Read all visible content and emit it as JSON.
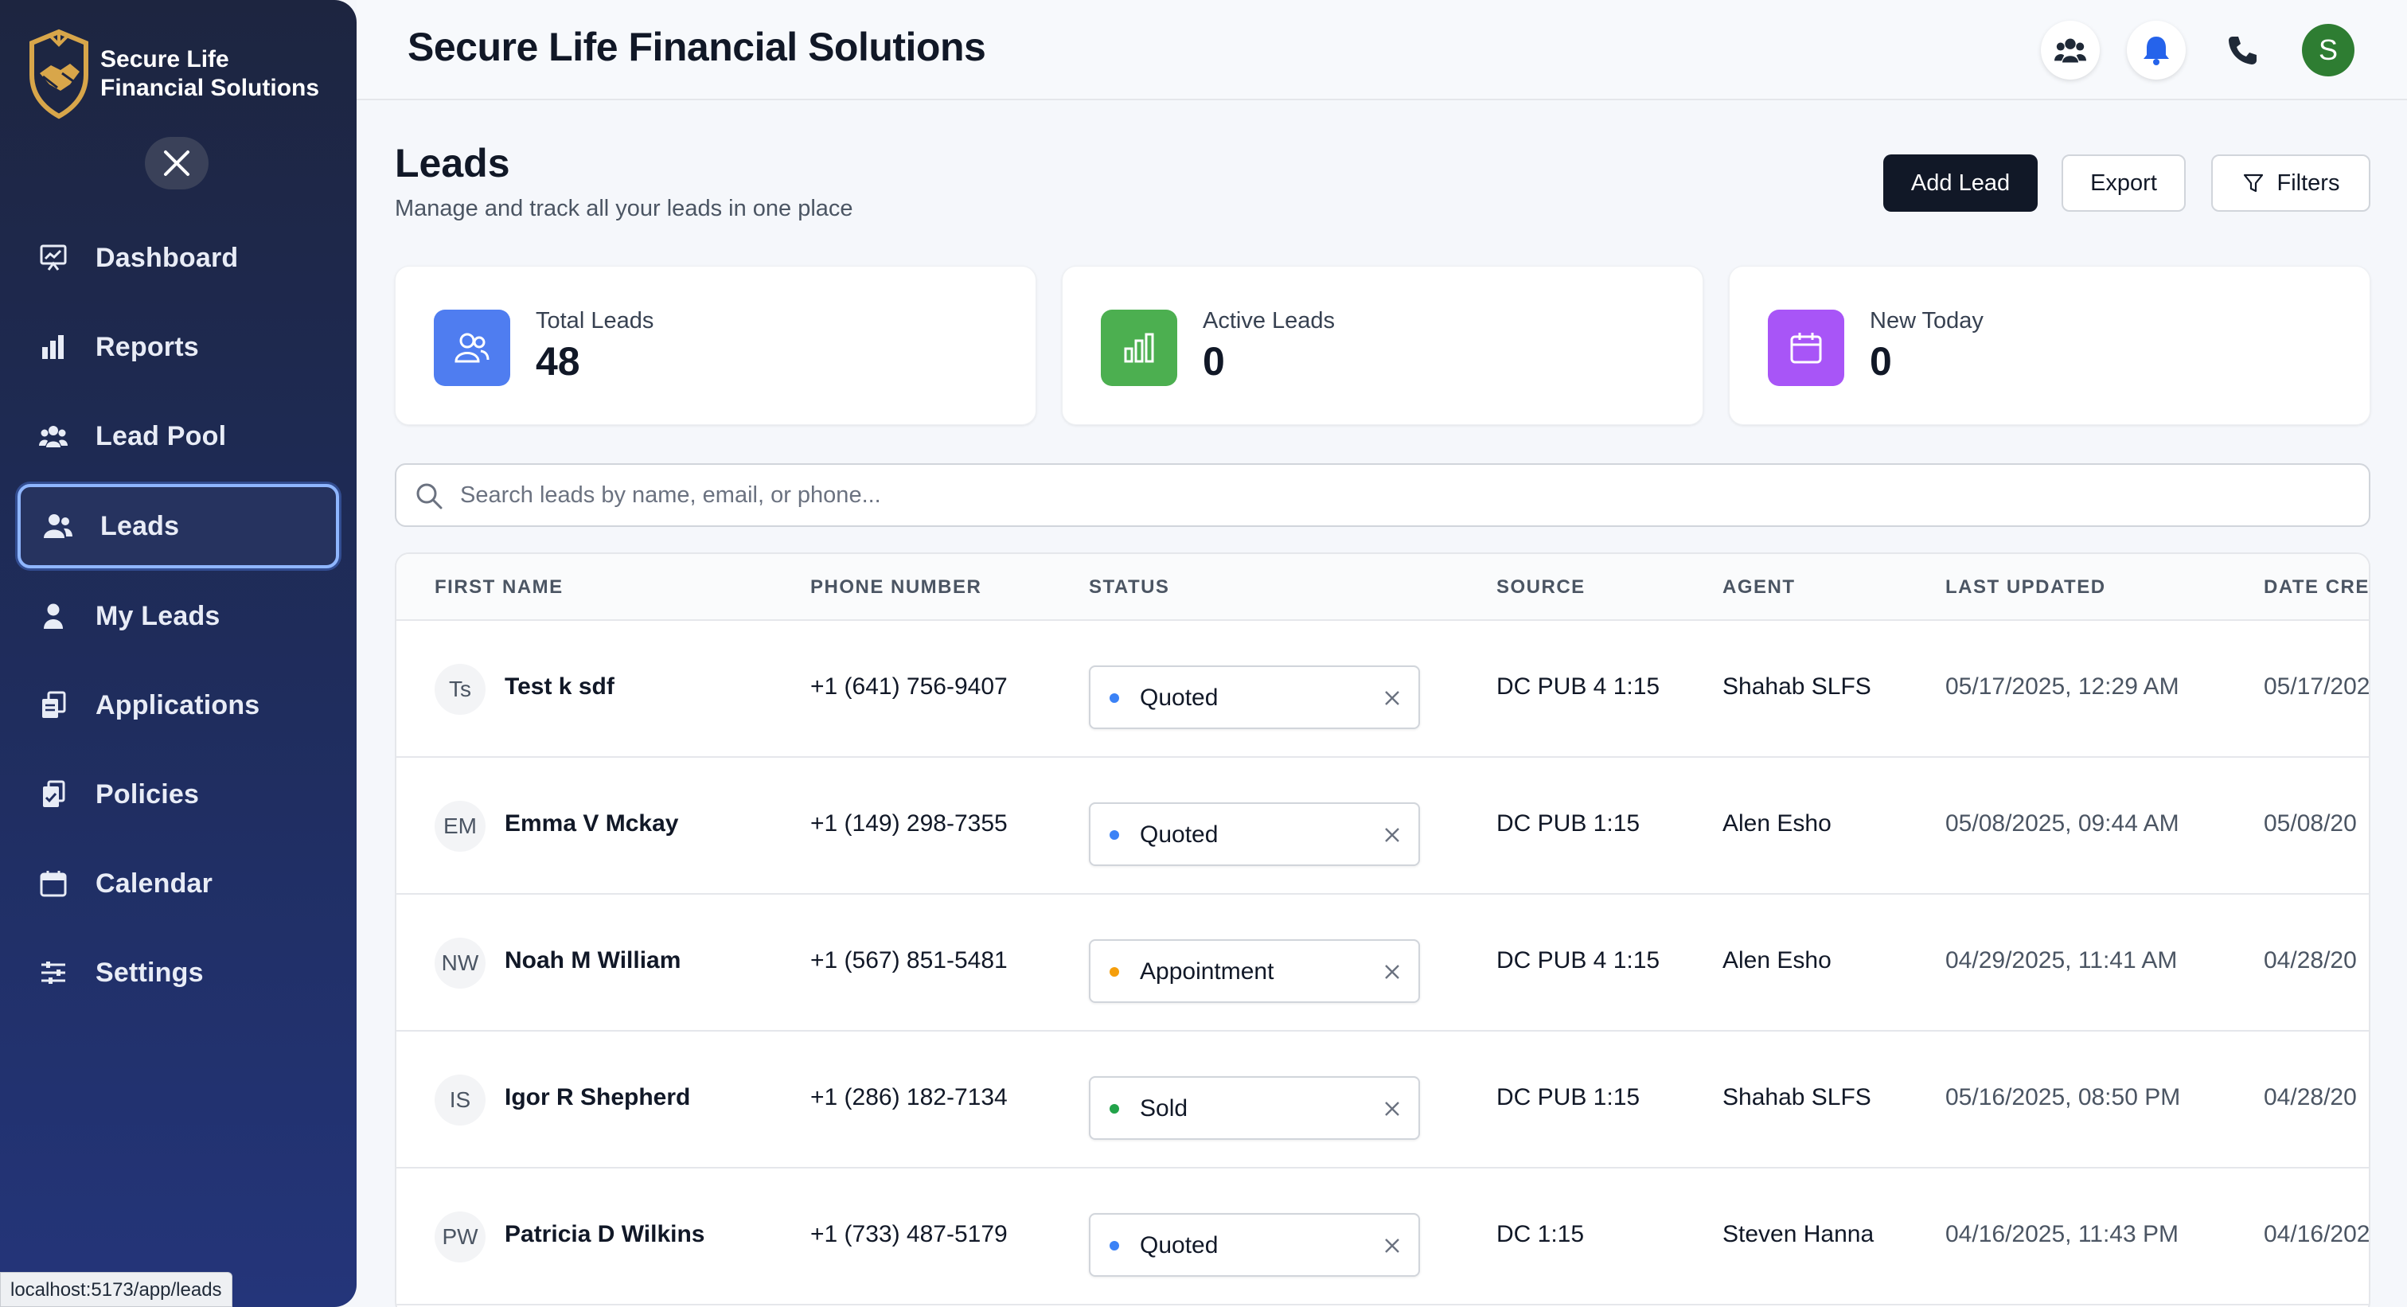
{
  "brand": {
    "line1": "Secure Life",
    "line2": "Financial Solutions"
  },
  "sidebar": {
    "items": [
      {
        "label": "Dashboard",
        "icon": "dashboard-icon"
      },
      {
        "label": "Reports",
        "icon": "bar-chart-icon"
      },
      {
        "label": "Lead Pool",
        "icon": "people-group-icon"
      },
      {
        "label": "Leads",
        "icon": "users-icon",
        "active": true
      },
      {
        "label": "My Leads",
        "icon": "user-icon"
      },
      {
        "label": "Applications",
        "icon": "applications-icon"
      },
      {
        "label": "Policies",
        "icon": "policy-icon"
      },
      {
        "label": "Calendar",
        "icon": "calendar-icon"
      },
      {
        "label": "Settings",
        "icon": "sliders-icon"
      }
    ]
  },
  "header": {
    "title": "Secure Life Financial Solutions",
    "avatar_initial": "S"
  },
  "page": {
    "title": "Leads",
    "subtitle": "Manage and track all your leads in one place"
  },
  "actions": {
    "add": "Add Lead",
    "export": "Export",
    "filters": "Filters"
  },
  "stats": [
    {
      "label": "Total Leads",
      "value": "48",
      "color": "#4f7df0",
      "icon": "users-icon"
    },
    {
      "label": "Active Leads",
      "value": "0",
      "color": "#4caf50",
      "icon": "bar-chart-icon"
    },
    {
      "label": "New Today",
      "value": "0",
      "color": "#a855f7",
      "icon": "calendar-icon"
    }
  ],
  "search": {
    "placeholder": "Search leads by name, email, or phone..."
  },
  "table": {
    "columns": [
      "FIRST NAME",
      "PHONE NUMBER",
      "STATUS",
      "SOURCE",
      "AGENT",
      "LAST UPDATED",
      "DATE CRE"
    ],
    "rows": [
      {
        "initials": "Ts",
        "name": "Test k sdf",
        "phone": "+1 (641) 756-9407",
        "status": "Quoted",
        "status_color": "#3b82f6",
        "source": "DC PUB 4 1:15",
        "agent": "Shahab SLFS",
        "updated": "05/17/2025, 12:29 AM",
        "created": "05/17/202"
      },
      {
        "initials": "EM",
        "name": "Emma V Mckay",
        "phone": "+1 (149) 298-7355",
        "status": "Quoted",
        "status_color": "#3b82f6",
        "source": "DC PUB 1:15",
        "agent": "Alen Esho",
        "updated": "05/08/2025, 09:44 AM",
        "created": "05/08/20"
      },
      {
        "initials": "NW",
        "name": "Noah M William",
        "phone": "+1 (567) 851-5481",
        "status": "Appointment",
        "status_color": "#f59e0b",
        "source": "DC PUB 4 1:15",
        "agent": "Alen Esho",
        "updated": "04/29/2025, 11:41 AM",
        "created": "04/28/20"
      },
      {
        "initials": "IS",
        "name": "Igor R Shepherd",
        "phone": "+1 (286) 182-7134",
        "status": "Sold",
        "status_color": "#22a34a",
        "source": "DC PUB 1:15",
        "agent": "Shahab SLFS",
        "updated": "05/16/2025, 08:50 PM",
        "created": "04/28/20"
      },
      {
        "initials": "PW",
        "name": "Patricia D Wilkins",
        "phone": "+1 (733) 487-5179",
        "status": "Quoted",
        "status_color": "#3b82f6",
        "source": "DC 1:15",
        "agent": "Steven Hanna",
        "updated": "04/16/2025, 11:43 PM",
        "created": "04/16/202"
      }
    ]
  },
  "status_bar": {
    "url": "localhost:5173/app/leads"
  }
}
